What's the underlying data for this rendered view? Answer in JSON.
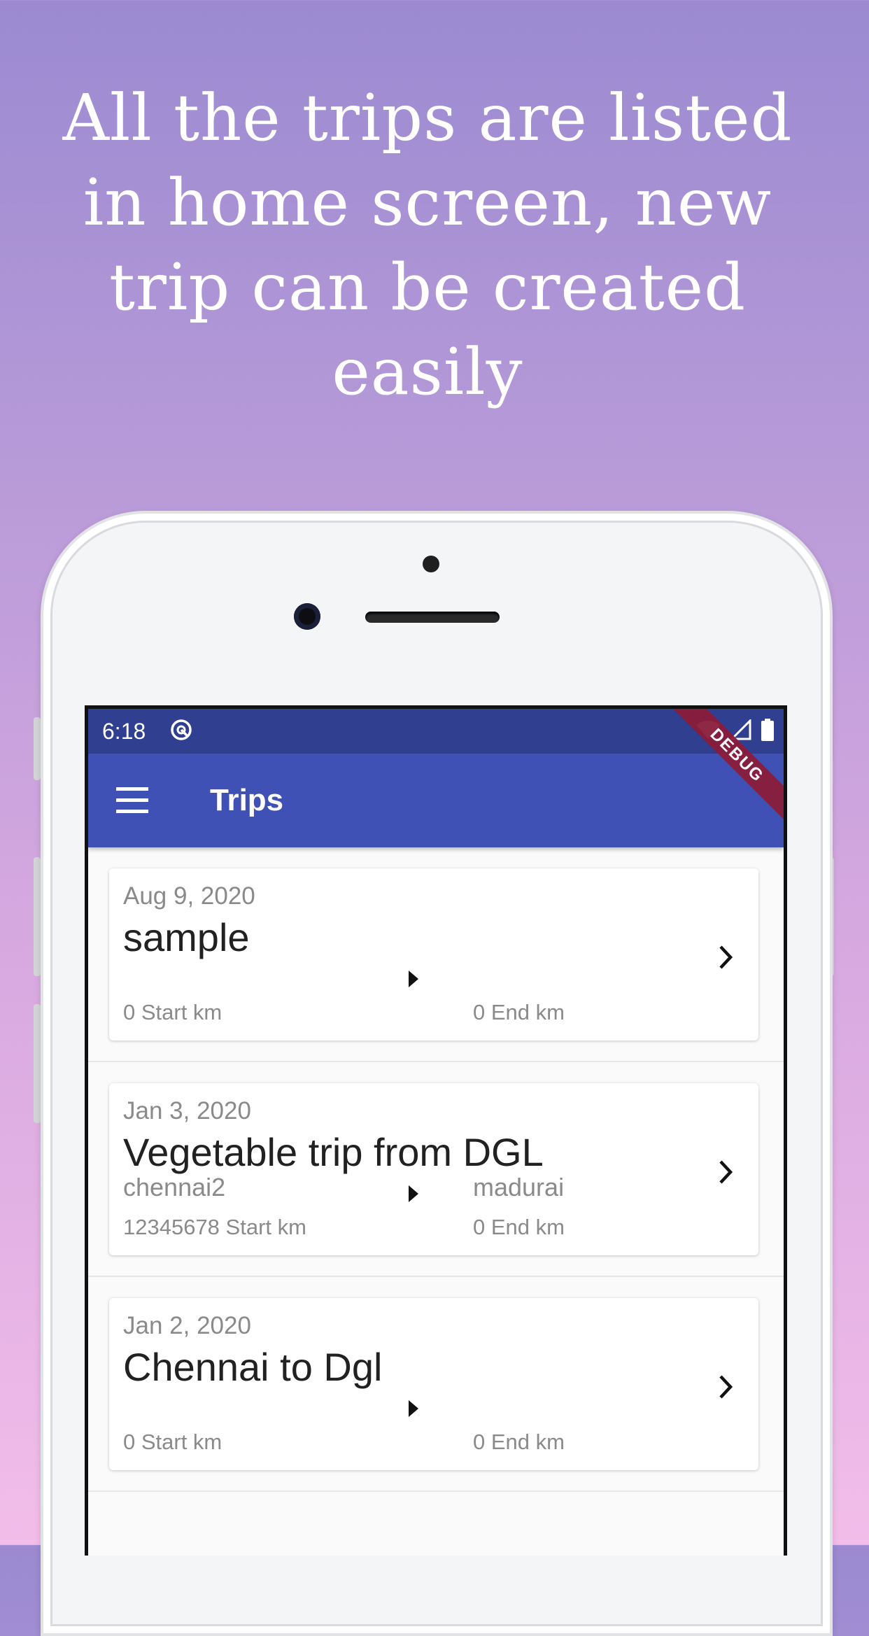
{
  "headline": "All the trips are listed in home screen, new trip can be created easily",
  "status_bar": {
    "time": "6:18"
  },
  "app_bar": {
    "title": "Trips",
    "debug_label": "DEBUG"
  },
  "trips": [
    {
      "date": "Aug 9, 2020",
      "title": "sample",
      "from": "",
      "to": "",
      "start": "0 Start km",
      "end": "0 End km"
    },
    {
      "date": "Jan 3, 2020",
      "title": "Vegetable trip from DGL",
      "from": "chennai2",
      "to": "madurai",
      "start": "12345678 Start km",
      "end": "0 End km"
    },
    {
      "date": "Jan 2, 2020",
      "title": "Chennai to Dgl",
      "from": "",
      "to": "",
      "start": "0 Start km",
      "end": "0 End km"
    }
  ],
  "colors": {
    "status_bar": "#303f8f",
    "app_bar": "#3f51b5",
    "debug_ribbon": "#8a1d3a"
  }
}
